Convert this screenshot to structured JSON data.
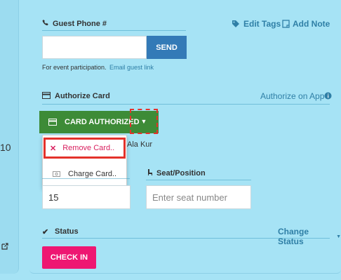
{
  "left": {
    "number": "10",
    "external_icon": "external-link-icon"
  },
  "guest_phone": {
    "label": "Guest Phone #",
    "input_value": "",
    "send_label": "SEND",
    "hint": "For event participation.",
    "email_link": "Email guest link",
    "edit_tags": "Edit Tags",
    "add_note": "Add Note"
  },
  "authorize_card": {
    "label": "Authorize Card",
    "authorize_on_app": "Authorize on App",
    "button_label": "CARD AUTHORIZED",
    "name_fragment": "Ala Kur"
  },
  "dropdown": {
    "remove_label": "Remove Card..",
    "charge_label": "Charge Card.."
  },
  "party": {
    "value": "15"
  },
  "seat": {
    "label": "Seat/Position",
    "placeholder": "Enter seat number",
    "value": ""
  },
  "status": {
    "label": "Status",
    "change_label": "Change Status",
    "checkin_label": "CHECK IN"
  },
  "colors": {
    "background": "#a6e3f5",
    "send": "#337ab7",
    "card_authorized": "#3d8b37",
    "check_in": "#ee1772",
    "highlight": "#e4322b"
  }
}
